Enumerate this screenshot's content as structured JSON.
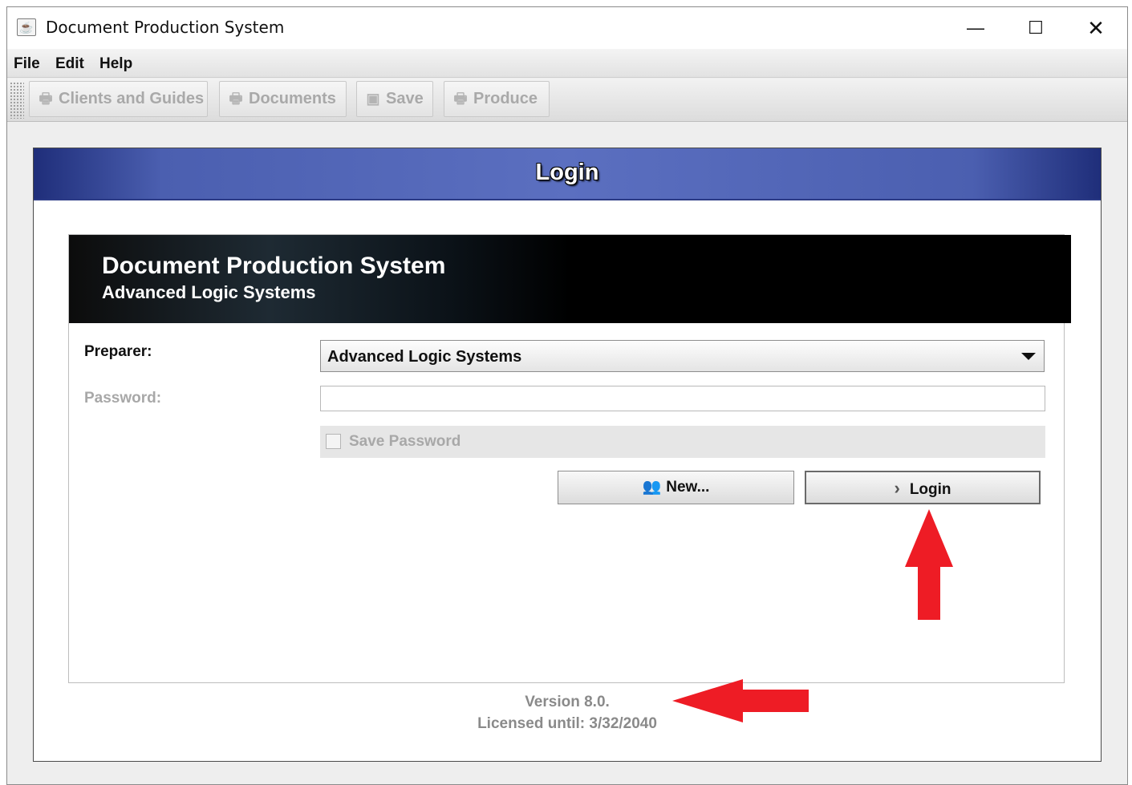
{
  "window": {
    "title": "Document Production System",
    "controls": {
      "minimize": "—",
      "maximize": "☐",
      "close": "✕"
    }
  },
  "menu": {
    "items": [
      "File",
      "Edit",
      "Help"
    ]
  },
  "toolbar": {
    "buttons": [
      {
        "label": "Clients and Guides",
        "icon": "printer-icon"
      },
      {
        "label": "Documents",
        "icon": "printer-icon"
      },
      {
        "label": "Save",
        "icon": "floppy-disk-icon"
      },
      {
        "label": "Produce",
        "icon": "printer-icon"
      }
    ]
  },
  "login_panel": {
    "header": "Login",
    "banner": {
      "title": "Document Production System",
      "subtitle": "Advanced Logic Systems"
    },
    "preparer_label": "Preparer:",
    "preparer_value": "Advanced Logic Systems",
    "password_label": "Password:",
    "password_value": "",
    "save_password_label": "Save Password",
    "save_password_checked": false,
    "new_button": "New...",
    "login_button": "Login"
  },
  "footer": {
    "version": "Version 8.0.",
    "licensed": "Licensed until: 3/32/2040"
  },
  "annotations": {
    "arrow_color": "#ee1c25"
  },
  "colors": {
    "header_blue": "#5b6fc0",
    "banner_black": "#000000"
  }
}
